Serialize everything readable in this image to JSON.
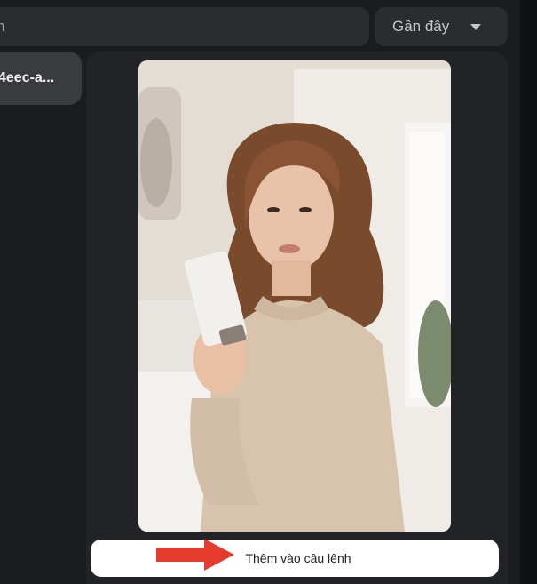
{
  "search": {
    "value": "",
    "placeholder": "n"
  },
  "sort": {
    "label": "Gần đây"
  },
  "sidebar": {
    "items": [
      {
        "label": "4eec-a..."
      }
    ]
  },
  "preview": {
    "image": "woman-holding-cream-tube-photo"
  },
  "actions": {
    "add_to_prompt": "Thêm vào câu lệnh"
  },
  "annotation": {
    "arrow_color": "#e53b2c"
  },
  "colors": {
    "background": "#1b1c1e",
    "panel": "#222326",
    "control": "#2b2c2f",
    "selected": "#3a3b3e"
  }
}
